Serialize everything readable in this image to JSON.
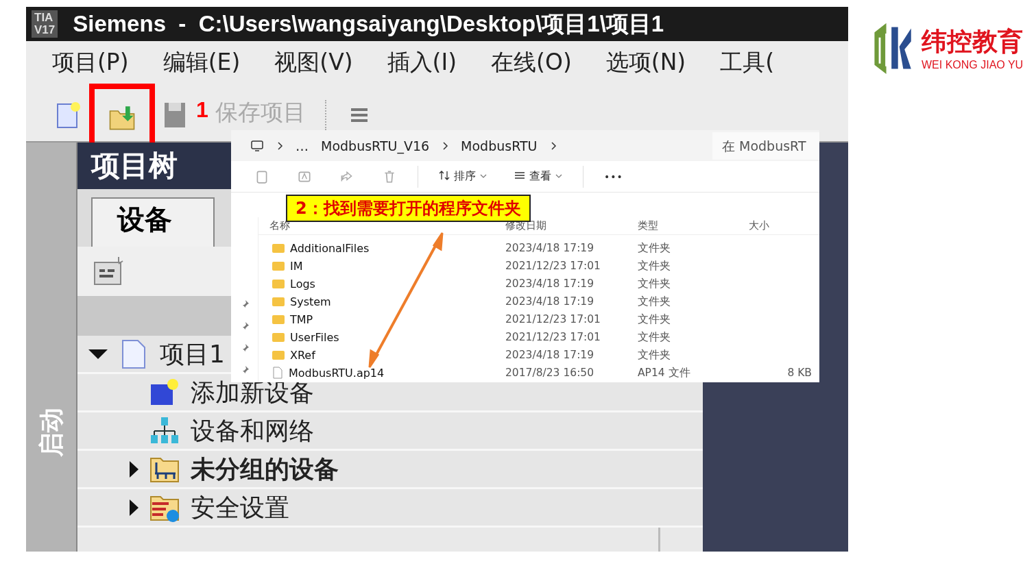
{
  "title_bar": {
    "badge_top": "TIA",
    "badge_bottom": "V17",
    "title": "Siemens  -  C:\\Users\\wangsaiyang\\Desktop\\项目1\\项目1"
  },
  "menu": [
    {
      "label": "项目(P)"
    },
    {
      "label": "编辑(E)"
    },
    {
      "label": "视图(V)"
    },
    {
      "label": "插入(I)"
    },
    {
      "label": "在线(O)"
    },
    {
      "label": "选项(N)"
    },
    {
      "label": "工具("
    }
  ],
  "toolbar": {
    "save_label": "保存项目",
    "step_marker": "1"
  },
  "sidebar": {
    "label": "启动"
  },
  "project_tree": {
    "title": "项目树",
    "tab": "设备",
    "items": [
      {
        "label": "项目1",
        "kind": "project",
        "expanded": true,
        "children": [
          {
            "label": "添加新设备",
            "kind": "add-device",
            "emphasized": false
          },
          {
            "label": "设备和网络",
            "kind": "network",
            "emphasized": false
          },
          {
            "label": "未分组的设备",
            "kind": "device-folder",
            "expanded": false,
            "emphasized": true
          },
          {
            "label": "安全设置",
            "kind": "security-folder",
            "expanded": false,
            "emphasized": false
          }
        ]
      }
    ]
  },
  "explorer": {
    "overflow": "…",
    "breadcrumb": [
      "ModbusRTU_V16",
      "ModbusRTU"
    ],
    "search_placeholder": "在 ModbusRT",
    "toolbar": {
      "sort": "排序",
      "view": "查看",
      "more": "•••"
    },
    "columns": [
      "名称",
      "修改日期",
      "类型",
      "大小"
    ],
    "rows": [
      {
        "name": "AdditionalFiles",
        "kind": "folder",
        "modified": "2023/4/18 17:19",
        "type": "文件夹"
      },
      {
        "name": "IM",
        "kind": "folder",
        "modified": "2021/12/23 17:01",
        "type": "文件夹"
      },
      {
        "name": "Logs",
        "kind": "folder",
        "modified": "2023/4/18 17:19",
        "type": "文件夹"
      },
      {
        "name": "System",
        "kind": "folder",
        "modified": "2023/4/18 17:19",
        "type": "文件夹"
      },
      {
        "name": "TMP",
        "kind": "folder",
        "modified": "2021/12/23 17:01",
        "type": "文件夹"
      },
      {
        "name": "UserFiles",
        "kind": "folder",
        "modified": "2021/12/23 17:01",
        "type": "文件夹"
      },
      {
        "name": "XRef",
        "kind": "folder",
        "modified": "2023/4/18 17:19",
        "type": "文件夹"
      },
      {
        "name": "ModbusRTU.ap14",
        "kind": "file",
        "modified": "2017/8/23 16:50",
        "type": "AP14 文件",
        "size": "8 KB"
      }
    ]
  },
  "callout": {
    "text": "2：找到需要打开的程序文件夹"
  },
  "logo": {
    "name": "纬控教育",
    "subtitle": "WEI KONG JIAO YU"
  }
}
